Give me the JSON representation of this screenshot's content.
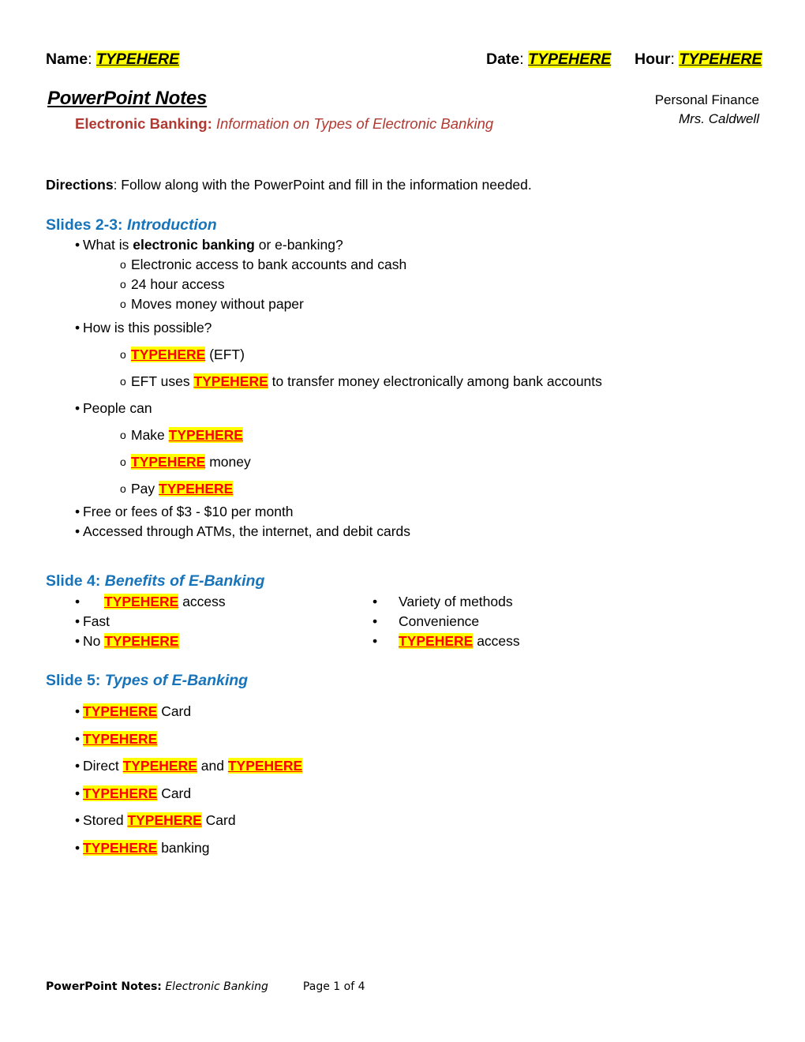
{
  "document": {
    "placeholder_token": "TYPEHERE",
    "colors": {
      "highlight": "#FFFF00",
      "placeholder_red": "#FF0000",
      "section_heading_blue": "#1874BA",
      "subtitle_red": "#B03A32"
    }
  },
  "identification": {
    "name_label": "Name",
    "name_value": "TYPEHERE",
    "date_label": "Date",
    "date_value": "TYPEHERE",
    "hour_label": "Hour",
    "hour_value": "TYPEHERE",
    "colon": ": "
  },
  "masthead": {
    "title": "PowerPoint Notes",
    "subtitle_lead": "Electronic Banking:",
    "subtitle_tail": " Information on Types of Electronic Banking",
    "course": "Personal Finance",
    "teacher": "Mrs. Caldwell"
  },
  "directions": {
    "label": "Directions",
    "text": ": Follow along with the PowerPoint and fill in the information needed."
  },
  "sections": [
    {
      "slide_label": "Slides 2-3: ",
      "topic": "Introduction",
      "items": [
        {
          "level": 1,
          "bullet": "•",
          "parts": [
            {
              "t": "What is ",
              "style": "plain"
            },
            {
              "t": "electronic banking",
              "style": "bold"
            },
            {
              "t": " or e-banking?",
              "style": "plain"
            }
          ]
        },
        {
          "level": 2,
          "bullet": "o",
          "parts": [
            {
              "t": "Electronic access to bank accounts and cash",
              "style": "plain"
            }
          ]
        },
        {
          "level": 2,
          "bullet": "o",
          "parts": [
            {
              "t": "24 hour access",
              "style": "plain"
            }
          ]
        },
        {
          "level": 2,
          "bullet": "o",
          "parts": [
            {
              "t": "Moves money without paper",
              "style": "plain"
            }
          ]
        },
        {
          "level": 1,
          "bullet": "•",
          "spaced": true,
          "parts": [
            {
              "t": "How is this possible?",
              "style": "plain"
            }
          ]
        },
        {
          "level": 2,
          "bullet": "o",
          "spaced": true,
          "parts": [
            {
              "t": "TYPEHERE",
              "style": "hl-red"
            },
            {
              "t": " (EFT)",
              "style": "plain"
            }
          ]
        },
        {
          "level": 2,
          "bullet": "o",
          "spaced": true,
          "parts": [
            {
              "t": "EFT uses ",
              "style": "plain"
            },
            {
              "t": "TYPEHERE",
              "style": "hl-red"
            },
            {
              "t": " to transfer money electronically among bank accounts",
              "style": "plain"
            }
          ]
        },
        {
          "level": 1,
          "bullet": "•",
          "spaced": true,
          "parts": [
            {
              "t": "People can",
              "style": "plain"
            }
          ]
        },
        {
          "level": 2,
          "bullet": "o",
          "spaced": true,
          "parts": [
            {
              "t": "Make ",
              "style": "plain"
            },
            {
              "t": "TYPEHERE",
              "style": "hl-red"
            }
          ]
        },
        {
          "level": 2,
          "bullet": "o",
          "spaced": true,
          "parts": [
            {
              "t": "TYPEHERE",
              "style": "hl-red"
            },
            {
              "t": " money",
              "style": "plain"
            }
          ]
        },
        {
          "level": 2,
          "bullet": "o",
          "spaced": true,
          "parts": [
            {
              "t": "Pay ",
              "style": "plain"
            },
            {
              "t": "TYPEHERE",
              "style": "hl-red"
            }
          ]
        },
        {
          "level": 1,
          "bullet": "•",
          "parts": [
            {
              "t": "Free or fees of $3 - $10 per month",
              "style": "plain"
            }
          ]
        },
        {
          "level": 1,
          "bullet": "•",
          "parts": [
            {
              "t": "Accessed through ATMs, the internet, and debit cards",
              "style": "plain"
            }
          ]
        }
      ]
    }
  ],
  "slide4": {
    "slide_label": "Slide 4: ",
    "topic": "Benefits of E-Banking",
    "column_left": [
      {
        "bullet": "•",
        "extra_indent": true,
        "parts": [
          {
            "t": "TYPEHERE",
            "style": "hl-red"
          },
          {
            "t": " access",
            "style": "plain"
          }
        ]
      },
      {
        "bullet": "•",
        "parts": [
          {
            "t": "Fast",
            "style": "plain"
          }
        ]
      },
      {
        "bullet": "•",
        "parts": [
          {
            "t": "No ",
            "style": "plain"
          },
          {
            "t": "TYPEHERE",
            "style": "hl-red"
          }
        ]
      }
    ],
    "column_right": [
      {
        "bullet": "•",
        "parts": [
          {
            "t": "Variety of methods",
            "style": "plain"
          }
        ]
      },
      {
        "bullet": "•",
        "parts": [
          {
            "t": "Convenience",
            "style": "plain"
          }
        ]
      },
      {
        "bullet": "•",
        "parts": [
          {
            "t": "TYPEHERE",
            "style": "hl-red"
          },
          {
            "t": " access",
            "style": "plain"
          }
        ]
      }
    ]
  },
  "slide5": {
    "slide_label": "Slide 5: ",
    "topic": "Types of E-Banking",
    "items": [
      {
        "bullet": "•",
        "parts": [
          {
            "t": "TYPEHERE",
            "style": "hl-red"
          },
          {
            "t": " Card",
            "style": "plain"
          }
        ]
      },
      {
        "bullet": "•",
        "parts": [
          {
            "t": "TYPEHERE",
            "style": "hl-red"
          }
        ]
      },
      {
        "bullet": "•",
        "parts": [
          {
            "t": "Direct ",
            "style": "plain"
          },
          {
            "t": "TYPEHERE",
            "style": "hl-red"
          },
          {
            "t": " and ",
            "style": "plain"
          },
          {
            "t": "TYPEHERE",
            "style": "hl-red"
          }
        ]
      },
      {
        "bullet": "•",
        "parts": [
          {
            "t": "TYPEHERE",
            "style": "hl-red"
          },
          {
            "t": " Card",
            "style": "plain"
          }
        ]
      },
      {
        "bullet": "•",
        "parts": [
          {
            "t": "Stored ",
            "style": "plain"
          },
          {
            "t": "TYPEHERE",
            "style": "hl-red"
          },
          {
            "t": " Card",
            "style": "plain"
          }
        ]
      },
      {
        "bullet": "•",
        "parts": [
          {
            "t": "TYPEHERE",
            "style": "hl-red"
          },
          {
            "t": " banking",
            "style": "plain"
          }
        ]
      }
    ]
  },
  "footer": {
    "title": "PowerPoint Notes:",
    "subject": " Electronic Banking",
    "page": "Page 1 of 4"
  }
}
